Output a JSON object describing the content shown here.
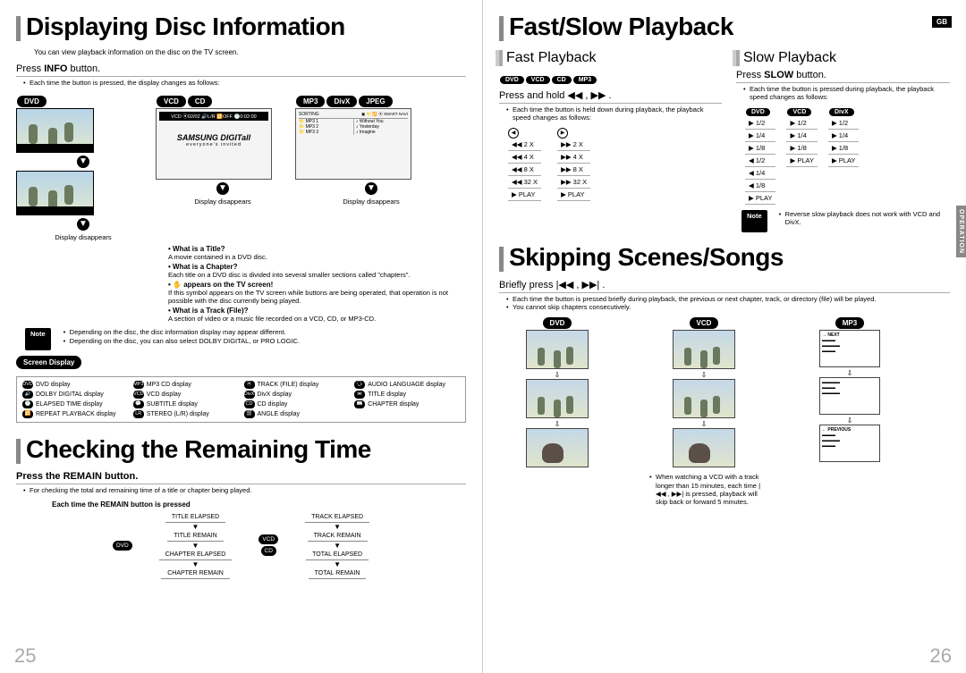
{
  "left_page": {
    "heading1": "Displaying Disc Information",
    "subtitle": "You can view playback information on the disc on the TV screen.",
    "sec1_head": "Press INFO button.",
    "sec1_b1": "Each time the button is pressed, the display changes as follows:",
    "badges_a": [
      "DVD"
    ],
    "badges_b": [
      "VCD",
      "CD"
    ],
    "badges_c": [
      "MP3",
      "DivX",
      "JPEG"
    ],
    "samsung": "SAMSUNG DIGITall",
    "samsung_sub": "everyone's invited",
    "disp": "Display disappears",
    "sort_head": "SORTING",
    "sort_items": [
      "MP3 1",
      "MP3 2",
      "MP3 3"
    ],
    "sort_r": [
      "Without You",
      "Yesterday",
      "Imagine"
    ],
    "qa": [
      {
        "q": "What is a Title?",
        "a": "A movie contained in a DVD disc."
      },
      {
        "q": "What is a Chapter?",
        "a": "Each title on a DVD disc is divided into several smaller sections called \"chapters\"."
      },
      {
        "q": "    appears on the TV screen!",
        "a": "If this symbol appears on the TV screen while buttons are being operated, that operation is not possible with the disc currently being played."
      },
      {
        "q": "What is a Track (File)?",
        "a": "A section of video or a music file recorded on a VCD, CD, or MP3-CD."
      }
    ],
    "note_label": "Note",
    "notes": [
      "Depending on the disc, the disc information display may appear different.",
      "Depending on the disc, you can also select DOLBY DIGITAL, or PRO LOGIC."
    ],
    "screen_display": "Screen Display",
    "legend": [
      {
        "i": "DVD",
        "t": "DVD display"
      },
      {
        "i": "MP3",
        "t": "MP3 CD display"
      },
      {
        "i": "⦿",
        "t": "TRACK (FILE) display"
      },
      {
        "i": "🗣",
        "t": "AUDIO LANGUAGE display"
      },
      {
        "i": "🔊",
        "t": "DOLBY DIGITAL display"
      },
      {
        "i": "VCD",
        "t": "VCD display"
      },
      {
        "i": "DivX",
        "t": "DivX display"
      },
      {
        "i": "📼",
        "t": "TITLE display"
      },
      {
        "i": "🕐",
        "t": "ELAPSED TIME display"
      },
      {
        "i": "💬",
        "t": "SUBTITLE display"
      },
      {
        "i": "CD",
        "t": "CD display"
      },
      {
        "i": "📖",
        "t": "CHAPTER display"
      },
      {
        "i": "🔁",
        "t": "REPEAT PLAYBACK display"
      },
      {
        "i": "LR",
        "t": "STEREO (L/R) display"
      },
      {
        "i": "🎬",
        "t": "ANGLE display"
      }
    ],
    "heading2": "Checking the Remaining Time",
    "sec2_head": "Press the REMAIN button.",
    "sec2_b1": "For checking the total and remaining time of a title or chapter being played.",
    "sec2_sub": "Each time the REMAIN button is pressed",
    "flow_dvd": [
      "TITLE ELAPSED",
      "TITLE REMAIN",
      "CHAPTER ELAPSED",
      "CHAPTER REMAIN"
    ],
    "flow_vcd": [
      "TRACK ELAPSED",
      "TRACK REMAIN",
      "TOTAL ELAPSED",
      "TOTAL REMAIN"
    ],
    "flow_badges": {
      "a": "DVD",
      "b": "VCD",
      "c": "CD"
    },
    "page_num": "25"
  },
  "right_page": {
    "gb": "GB",
    "side": "OPERATION",
    "heading1": "Fast/Slow Playback",
    "fast_h": "Fast Playback",
    "slow_h": "Slow Playback",
    "fast_badges": [
      "DVD",
      "VCD",
      "CD",
      "MP3"
    ],
    "fast_inst": "Press and hold ◀◀ , ▶▶ .",
    "fast_b1": "Each time the button is held down during playback, the playback speed changes as follows:",
    "slow_inst": "Press SLOW button.",
    "slow_b1": "Each time the button is pressed during playback, the playback speed changes as follows:",
    "fast_left": [
      "◀◀ 2 X",
      "◀◀ 4 X",
      "◀◀ 8 X",
      "◀◀ 32 X",
      "▶ PLAY"
    ],
    "fast_right": [
      "▶▶ 2 X",
      "▶▶ 4 X",
      "▶▶ 8 X",
      "▶▶ 32 X",
      "▶ PLAY"
    ],
    "slow_dvd": [
      "▶ 1/2",
      "▶ 1/4",
      "▶ 1/8",
      "◀ 1/2",
      "◀ 1/4",
      "◀ 1/8",
      "▶ PLAY"
    ],
    "slow_vcd": [
      "▶ 1/2",
      "▶ 1/4",
      "▶ 1/8",
      "▶ PLAY"
    ],
    "slow_divx": [
      "▶ 1/2",
      "▶ 1/4",
      "▶ 1/8",
      "▶ PLAY"
    ],
    "slow_cols": [
      "DVD",
      "VCD",
      "DivX"
    ],
    "note_label": "Note",
    "slow_note": "Reverse slow playback does not work with VCD and DivX.",
    "heading2": "Skipping Scenes/Songs",
    "skip_inst": "Briefly press |◀◀ , ▶▶| .",
    "skip_b": [
      "Each time the button is pressed briefly during playback, the previous or next chapter, track, or directory (file) will be played.",
      "You cannot skip chapters consecutively."
    ],
    "skip_cols": [
      "DVD",
      "VCD",
      "MP3"
    ],
    "mp3_tags": [
      "→ NEXT",
      "← PREVIOUS"
    ],
    "skip_note": [
      "When watching a VCD with a track longer than 15 minutes, each time |◀◀ , ▶▶| is pressed, playback will skip back or forward 5 minutes."
    ],
    "page_num": "26"
  }
}
